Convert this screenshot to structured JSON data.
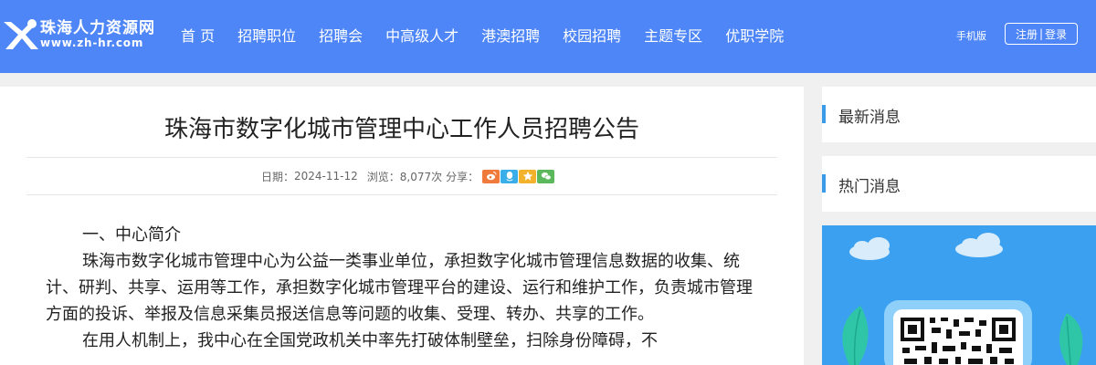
{
  "header": {
    "logo_cn": "珠海人力资源网",
    "logo_url": "www.zh-hr.com",
    "nav": [
      {
        "label": "首 页",
        "name": "nav-home"
      },
      {
        "label": "招聘职位",
        "name": "nav-jobs"
      },
      {
        "label": "招聘会",
        "name": "nav-job-fair"
      },
      {
        "label": "中高级人才",
        "name": "nav-senior-talent"
      },
      {
        "label": "港澳招聘",
        "name": "nav-hk-macau"
      },
      {
        "label": "校园招聘",
        "name": "nav-campus"
      },
      {
        "label": "主题专区",
        "name": "nav-topics"
      },
      {
        "label": "优职学院",
        "name": "nav-academy"
      }
    ],
    "mobile_label": "手机版",
    "register_label": "注册",
    "login_label": "登录",
    "auth_separator": "|"
  },
  "article": {
    "title": "珠海市数字化城市管理中心工作人员招聘公告",
    "date_label": "日期：",
    "date": "2024-11-12",
    "views_label": "浏览：",
    "views": "8,077次",
    "share_label": "分享：",
    "share_icons": [
      {
        "name": "weibo-icon",
        "color": "#f07a3c"
      },
      {
        "name": "qq-icon",
        "color": "#3aaee9"
      },
      {
        "name": "qzone-icon",
        "color": "#f3b22c"
      },
      {
        "name": "wechat-icon",
        "color": "#5cb85c"
      }
    ],
    "heading": "一、中心简介",
    "para1": "珠海市数字化城市管理中心为公益一类事业单位，承担数字化城市管理信息数据的收集、统计、研判、共享、运用等工作，承担数字化城市管理平台的建设、运行和维护工作，负责城市管理方面的投诉、举报及信息采集员报送信息等问题的收集、受理、转办、共享的工作。",
    "para2": "在用人机制上，我中心在全国党政机关中率先打破体制壁垒，扫除身份障碍，不"
  },
  "sidebar": {
    "latest_title": "最新消息",
    "hot_title": "热门消息"
  },
  "colors": {
    "header_bg": "#4e86f7",
    "accent_bar": "#3a9be8",
    "qr_bg": "#3ba0f0"
  }
}
